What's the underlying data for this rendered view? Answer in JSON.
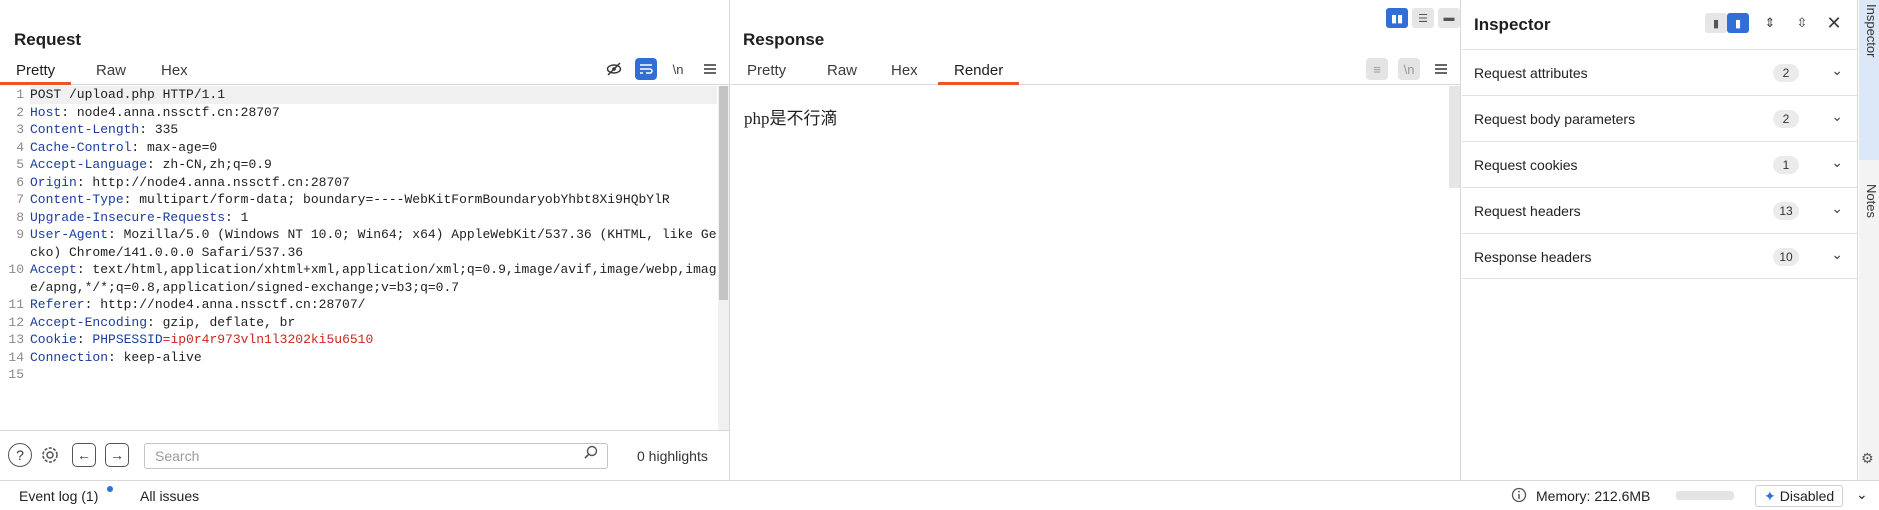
{
  "request": {
    "title": "Request",
    "tabs": [
      "Pretty",
      "Raw",
      "Hex"
    ],
    "active_tab": "Pretty",
    "toolbar_icons": [
      "eye-off-icon",
      "wrap-icon",
      "newline-icon",
      "menu-icon"
    ],
    "newline_label": "\\n",
    "lines": [
      {
        "n": "1",
        "key": "",
        "val": "POST /upload.php HTTP/1.1"
      },
      {
        "n": "2",
        "key": "Host",
        "val": ": node4.anna.nssctf.cn:28707"
      },
      {
        "n": "3",
        "key": "Content-Length",
        "val": ": 335"
      },
      {
        "n": "4",
        "key": "Cache-Control",
        "val": ": max-age=0"
      },
      {
        "n": "5",
        "key": "Accept-Language",
        "val": ": zh-CN,zh;q=0.9"
      },
      {
        "n": "6",
        "key": "Origin",
        "val": ": http://node4.anna.nssctf.cn:28707"
      },
      {
        "n": "7",
        "key": "Content-Type",
        "val": ": multipart/form-data; boundary=----WebKitFormBoundaryobYhbt8Xi9HQbYlR"
      },
      {
        "n": "8",
        "key": "Upgrade-Insecure-Requests",
        "val": ": 1"
      },
      {
        "n": "9",
        "key": "User-Agent",
        "val": ": Mozilla/5.0 (Windows NT 10.0; Win64; x64) AppleWebKit/537.36 (KHTML, like Gecko) Chrome/141.0.0.0 Safari/537.36"
      },
      {
        "n": "10",
        "key": "Accept",
        "val": ": text/html,application/xhtml+xml,application/xml;q=0.9,image/avif,image/webp,image/apng,*/*;q=0.8,application/signed-exchange;v=b3;q=0.7"
      },
      {
        "n": "11",
        "key": "Referer",
        "val": ": http://node4.anna.nssctf.cn:28707/"
      },
      {
        "n": "12",
        "key": "Accept-Encoding",
        "val": ": gzip, deflate, br"
      },
      {
        "n": "13",
        "key": "Cookie",
        "val": ": ",
        "cookie_name": "PHPSESSID",
        "cookie_value": "=ip0r4r973vln1l3202ki5u6510"
      },
      {
        "n": "14",
        "key": "Connection",
        "val": ": keep-alive"
      },
      {
        "n": "15",
        "key": "",
        "val": ""
      }
    ],
    "search": {
      "placeholder": "Search",
      "highlights": "0 highlights"
    }
  },
  "response": {
    "title": "Response",
    "tabs": [
      "Pretty",
      "Raw",
      "Hex",
      "Render"
    ],
    "active_tab": "Render",
    "rendered_text": "php是不行滴",
    "newline_label": "\\n"
  },
  "inspector": {
    "title": "Inspector",
    "rows": [
      {
        "label": "Request attributes",
        "count": "2"
      },
      {
        "label": "Request body parameters",
        "count": "2"
      },
      {
        "label": "Request cookies",
        "count": "1"
      },
      {
        "label": "Request headers",
        "count": "13"
      },
      {
        "label": "Response headers",
        "count": "10"
      }
    ]
  },
  "right_rail": {
    "tabs": [
      "Inspector",
      "Notes"
    ]
  },
  "statusbar": {
    "event_log": "Event log (1)",
    "all_issues": "All issues",
    "memory": "Memory: 212.6MB",
    "memory_fraction": 0.0,
    "ai_button": "Disabled"
  },
  "colors": {
    "accent_tab": "#e8562a",
    "accent_blue": "#2f6fd6",
    "header_key": "#1a3d9e",
    "cookie_value": "#c8281e"
  }
}
